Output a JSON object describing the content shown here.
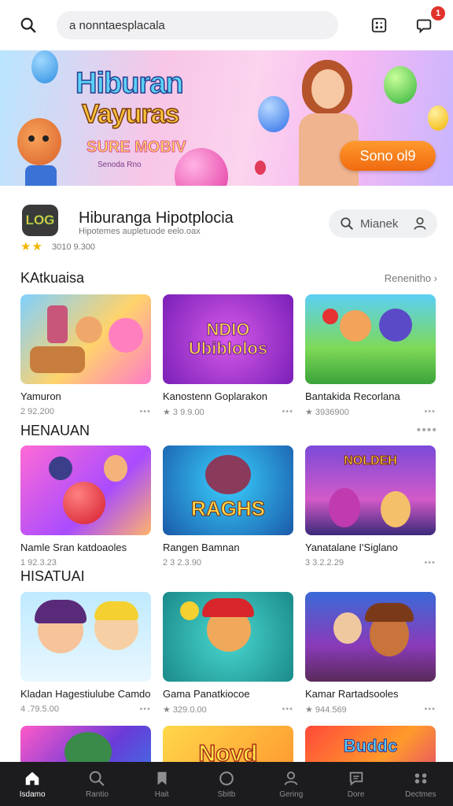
{
  "search": {
    "placeholder": "a nonntaesplacala"
  },
  "notifications": {
    "count": "1"
  },
  "banner": {
    "title_line1": "Hiburan",
    "title_line2": "Vayuras",
    "tag": "SURE MOBIV",
    "small": "Senoda Rno",
    "cta": "Sono ol9"
  },
  "app": {
    "logo_text": "LOG",
    "title": "Hiburanga Hipotplocia",
    "subtitle": "Hipotemes aupletuode eelo.oax",
    "stars": "★★",
    "rating": "3010 9.300",
    "market_label": "Mianek"
  },
  "section1": {
    "title": "KAtkuaisa",
    "link": "Renenitho ›",
    "cards": [
      {
        "title": "Yamuron",
        "meta": "2 92.200",
        "art": ""
      },
      {
        "title": "Kanostenn Goplarakon",
        "meta": "★ 3 9.9.00",
        "art": "NDIO Ubiblolos"
      },
      {
        "title": "Bantakida Recorlana",
        "meta": "★ 3936900",
        "art": ""
      }
    ]
  },
  "section2": {
    "title": "HENAUAN",
    "cards": [
      {
        "title": "Namle Sran katdoaoles",
        "meta": "1 92.3.23",
        "art": ""
      },
      {
        "title": "Rangen Bamnan",
        "meta": "2 3 2.3.90",
        "art": "RAGHS"
      },
      {
        "title": "Yanatalane I'Siglano",
        "meta": "3 3.2.2.29",
        "art": "NOLDEH"
      }
    ]
  },
  "section3": {
    "title": "HISATUAI",
    "cards": [
      {
        "title": "Kladan Hagestiulube Camdo",
        "meta": "4 .79.5.00",
        "art": ""
      },
      {
        "title": "Gama Panatkiocoe",
        "meta": "★ 329.0.00",
        "art": ""
      },
      {
        "title": "Kamar Rartadsooles",
        "meta": "★ 944.569",
        "art": ""
      }
    ]
  },
  "section4": {
    "cards": [
      {
        "art": ""
      },
      {
        "art": "Novd"
      },
      {
        "art": "Buddc"
      }
    ]
  },
  "nav": {
    "items": [
      {
        "label": "Isdamo",
        "icon": "home-icon"
      },
      {
        "label": "Rantio",
        "icon": "search-icon"
      },
      {
        "label": "Hait",
        "icon": "bookmark-icon"
      },
      {
        "label": "Sbitb",
        "icon": "circle-icon"
      },
      {
        "label": "Gering",
        "icon": "user-icon"
      },
      {
        "label": "Dore",
        "icon": "chat-icon"
      },
      {
        "label": "Dectmes",
        "icon": "controller-icon"
      }
    ]
  },
  "colors": {
    "accent": "#f06a10",
    "badge": "#e0322b",
    "nav_bg": "#1c1c1e"
  }
}
